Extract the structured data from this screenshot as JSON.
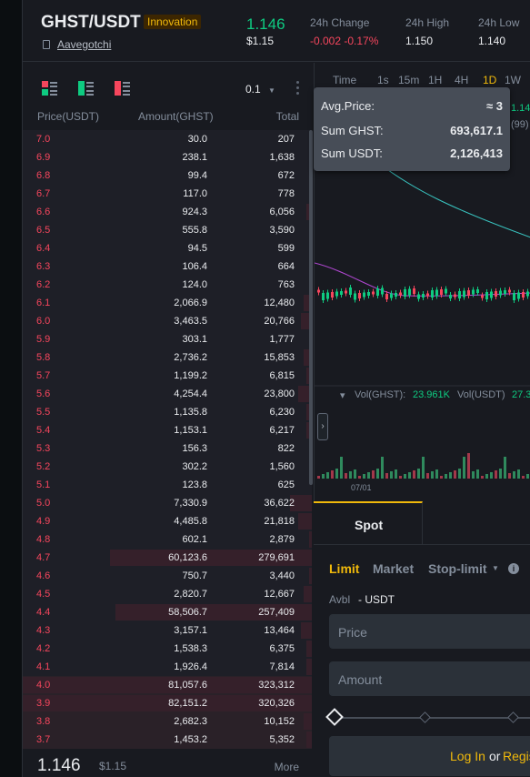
{
  "header": {
    "pair": "GHST/USDT",
    "badge": "Innovation",
    "coin_name": "Aavegotchi",
    "last_price": "1.146",
    "last_price_usd": "$1.15",
    "change_label": "24h Change",
    "change_value": "-0.002 -0.17%",
    "high_label": "24h High",
    "high_value": "1.150",
    "low_label": "24h Low",
    "low_value": "1.140"
  },
  "orderbook": {
    "precision": "0.1",
    "col_price": "Price(USDT)",
    "col_amount": "Amount(GHST)",
    "col_total": "Total",
    "asks": [
      {
        "price": "7.0",
        "amount": "30.0",
        "total": "207",
        "depth": 0
      },
      {
        "price": "6.9",
        "amount": "238.1",
        "total": "1,638",
        "depth": 0
      },
      {
        "price": "6.8",
        "amount": "99.4",
        "total": "672",
        "depth": 0
      },
      {
        "price": "6.7",
        "amount": "117.0",
        "total": "778",
        "depth": 0
      },
      {
        "price": "6.6",
        "amount": "924.3",
        "total": "6,056",
        "depth": 0.02
      },
      {
        "price": "6.5",
        "amount": "555.8",
        "total": "3,590",
        "depth": 0.01
      },
      {
        "price": "6.4",
        "amount": "94.5",
        "total": "599",
        "depth": 0
      },
      {
        "price": "6.3",
        "amount": "106.4",
        "total": "664",
        "depth": 0
      },
      {
        "price": "6.2",
        "amount": "124.0",
        "total": "763",
        "depth": 0
      },
      {
        "price": "6.1",
        "amount": "2,066.9",
        "total": "12,480",
        "depth": 0.03
      },
      {
        "price": "6.0",
        "amount": "3,463.5",
        "total": "20,766",
        "depth": 0.04
      },
      {
        "price": "5.9",
        "amount": "303.1",
        "total": "1,777",
        "depth": 0
      },
      {
        "price": "5.8",
        "amount": "2,736.2",
        "total": "15,853",
        "depth": 0.03
      },
      {
        "price": "5.7",
        "amount": "1,199.2",
        "total": "6,815",
        "depth": 0.02
      },
      {
        "price": "5.6",
        "amount": "4,254.4",
        "total": "23,800",
        "depth": 0.05
      },
      {
        "price": "5.5",
        "amount": "1,135.8",
        "total": "6,230",
        "depth": 0.02
      },
      {
        "price": "5.4",
        "amount": "1,153.1",
        "total": "6,217",
        "depth": 0.02
      },
      {
        "price": "5.3",
        "amount": "156.3",
        "total": "822",
        "depth": 0
      },
      {
        "price": "5.2",
        "amount": "302.2",
        "total": "1,560",
        "depth": 0
      },
      {
        "price": "5.1",
        "amount": "123.8",
        "total": "625",
        "depth": 0
      },
      {
        "price": "5.0",
        "amount": "7,330.9",
        "total": "36,622",
        "depth": 0.08
      },
      {
        "price": "4.9",
        "amount": "4,485.8",
        "total": "21,818",
        "depth": 0.05
      },
      {
        "price": "4.8",
        "amount": "602.1",
        "total": "2,879",
        "depth": 0.01
      },
      {
        "price": "4.7",
        "amount": "60,123.6",
        "total": "279,691",
        "depth": 0.74
      },
      {
        "price": "4.6",
        "amount": "750.7",
        "total": "3,440",
        "depth": 0.01
      },
      {
        "price": "4.5",
        "amount": "2,820.7",
        "total": "12,667",
        "depth": 0.03
      },
      {
        "price": "4.4",
        "amount": "58,506.7",
        "total": "257,409",
        "depth": 0.72
      },
      {
        "price": "4.3",
        "amount": "3,157.1",
        "total": "13,464",
        "depth": 0.04
      },
      {
        "price": "4.2",
        "amount": "1,538.3",
        "total": "6,375",
        "depth": 0.02
      },
      {
        "price": "4.1",
        "amount": "1,926.4",
        "total": "7,814",
        "depth": 0.02
      },
      {
        "price": "4.0",
        "amount": "81,057.6",
        "total": "323,312",
        "depth": 1.0
      },
      {
        "price": "3.9",
        "amount": "82,151.2",
        "total": "320,326",
        "depth": 1.0
      },
      {
        "price": "3.8",
        "amount": "2,682.3",
        "total": "10,152",
        "depth": 0.03
      },
      {
        "price": "3.7",
        "amount": "1,453.2",
        "total": "5,352",
        "depth": 0.02
      }
    ],
    "footer_price": "1.146",
    "footer_usd": "$1.15",
    "more_label": "More"
  },
  "chart": {
    "timeframes": [
      "Time",
      "1s",
      "15m",
      "1H",
      "4H",
      "1D",
      "1W"
    ],
    "active_timeframe": "1D",
    "price_partial": "1.14",
    "ma_partial": "(99)",
    "vol_ghst_label": "Vol(GHST):",
    "vol_ghst_value": "23.961K",
    "vol_usdt_label": "Vol(USDT)",
    "vol_usdt_value": "27.3",
    "date_label": "07/01"
  },
  "tooltip": {
    "avg_label": "Avg.Price:",
    "avg_value": "≈ 3",
    "sum_base_label": "Sum GHST:",
    "sum_base_value": "693,617.1",
    "sum_quote_label": "Sum USDT:",
    "sum_quote_value": "2,126,413"
  },
  "trade": {
    "tab_spot": "Spot",
    "order_limit": "Limit",
    "order_market": "Market",
    "order_stoplimit": "Stop-limit",
    "avbl_label": "Avbl",
    "avbl_value": "- USDT",
    "price_placeholder": "Price",
    "amount_placeholder": "Amount",
    "login_label": "Log In",
    "or_label": "or",
    "register_label": "Regis"
  },
  "colors": {
    "up": "#0ecb81",
    "down": "#f6465d",
    "accent": "#f0b90b"
  }
}
